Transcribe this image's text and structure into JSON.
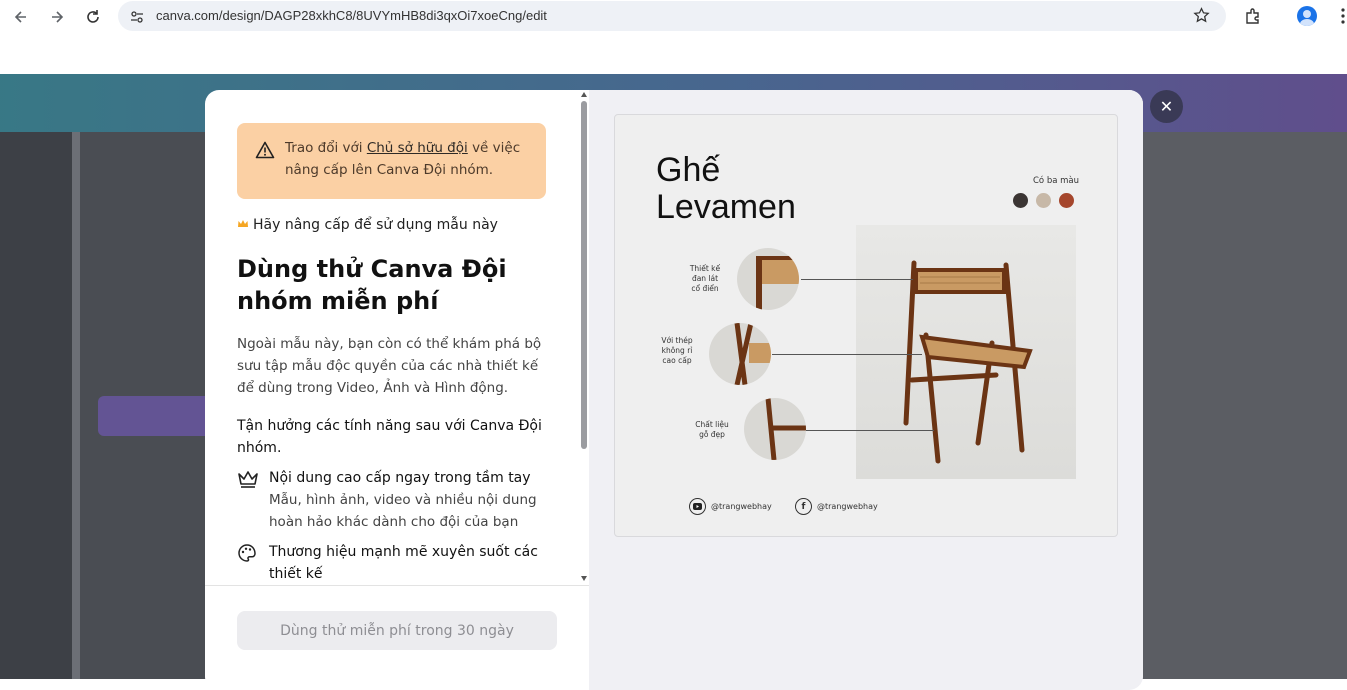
{
  "browser": {
    "url": "canva.com/design/DAGP28xkhC8/8UVYmHB8di3qxOi7xoeCng/edit"
  },
  "modal": {
    "notice": {
      "prefix": "Trao đổi với ",
      "link": "Chủ sở hữu đội",
      "suffix": " về việc nâng cấp lên Canva Đội nhóm."
    },
    "upgrade_label": "Hãy nâng cấp để sử dụng mẫu này",
    "title": "Dùng thử Canva Đội nhóm miễn phí",
    "description": "Ngoài mẫu này, bạn còn có thể khám phá bộ sưu tập mẫu độc quyền của các nhà thiết kế để dùng trong Video, Ảnh và Hình động.",
    "features_heading": "Tận hưởng các tính năng sau với Canva Đội nhóm.",
    "features": [
      {
        "icon": "crown-icon",
        "title": "Nội dung cao cấp ngay trong tầm tay",
        "description": "Mẫu, hình ảnh, video và nhiều nội dung hoàn hảo khác dành cho đội của bạn"
      },
      {
        "icon": "palette-icon",
        "title": "Thương hiệu mạnh mẽ xuyên suốt các thiết kế",
        "description": ""
      }
    ],
    "trial_button": "Dùng thử miễn phí trong 30 ngày",
    "close_icon": "close-icon",
    "notice_color": "#fbd0a4"
  },
  "preview": {
    "title_line1": "Ghế",
    "title_line2": "Levamen",
    "colors_label": "Có ba màu",
    "colors": [
      "#3b3533",
      "#c7b8a7",
      "#a5462c"
    ],
    "details": [
      {
        "label_lines": [
          "Thiết kế",
          "đan lát",
          "cổ điển"
        ]
      },
      {
        "label_lines": [
          "Với thép",
          "không rỉ",
          "cao cấp"
        ]
      },
      {
        "label_lines": [
          "Chất liệu",
          "gỗ đẹp"
        ]
      }
    ],
    "socials": [
      {
        "icon": "youtube-icon",
        "handle": "@trangwebhay"
      },
      {
        "icon": "facebook-icon",
        "handle": "@trangwebhay"
      }
    ]
  }
}
